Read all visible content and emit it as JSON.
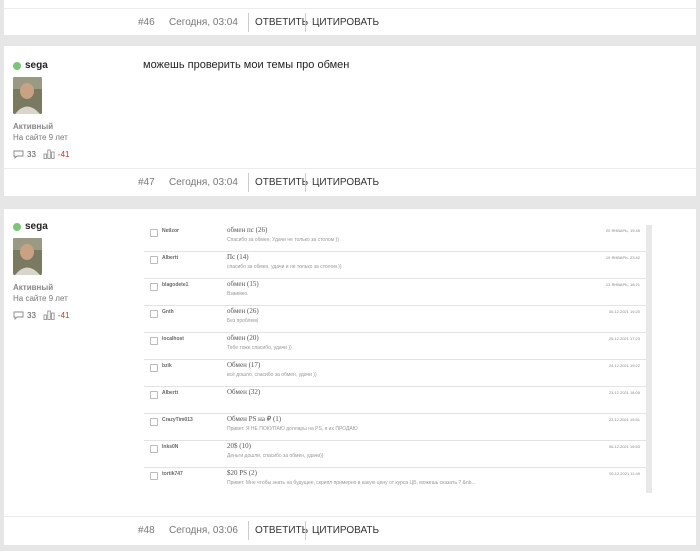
{
  "posts": [
    {
      "number": "#46",
      "date": "Сегодня, 03:04",
      "reply_label": "ОТВЕТИТЬ",
      "quote_label": "ЦИТИРОВАТЬ"
    },
    {
      "author": "sega",
      "status": "Активный",
      "tenure": "На сайте 9 лет",
      "comments": "33",
      "rating": "-41",
      "message": "можешь проверить мои темы про обмен",
      "number": "#47",
      "date": "Сегодня, 03:04",
      "reply_label": "ОТВЕТИТЬ",
      "quote_label": "ЦИТИРОВАТЬ"
    },
    {
      "author": "sega",
      "status": "Активный",
      "tenure": "На сайте 9 лет",
      "comments": "33",
      "rating": "-41",
      "number": "#48",
      "date": "Сегодня, 03:06",
      "reply_label": "ОТВЕТИТЬ",
      "quote_label": "ЦИТИРОВАТЬ",
      "screenshot_rows": [
        {
          "user": "NetIzor",
          "subject": "обмен пс",
          "count": "(26)",
          "snippet": "Спасибо за обмен, Удачи не только за столом ))",
          "date": "20 ЯНВАРЬ, 19:45"
        },
        {
          "user": "Albertt",
          "subject": "Пс",
          "count": "(14)",
          "snippet": "спасибо за обмен, удачи и не только за столом ))",
          "date": "19 ЯНВАРЬ, 23:42"
        },
        {
          "user": "blagodete1",
          "subject": "обмен",
          "count": "(15)",
          "snippet": "Взаимно.",
          "date": "13 ЯНВАРЬ, 18:21"
        },
        {
          "user": "Gnth",
          "subject": "обмен",
          "count": "(26)",
          "snippet": "Без проблем)",
          "date": "30.12.2021 19:20"
        },
        {
          "user": "localhost",
          "subject": "обмен",
          "count": "(20)",
          "snippet": "Тебе тоже спасибо, удачи ))",
          "date": "25.12.2021 17:23"
        },
        {
          "user": "bzik",
          "subject": "Обмен",
          "count": "(17)",
          "snippet": "всё дошло, спасибо за обмен, удачи ))",
          "date": "24.12.2021 19:22"
        },
        {
          "user": "Albertt",
          "subject": "Обмен",
          "count": "(32)",
          "snippet": "",
          "date": "23.12.2021 18:05"
        },
        {
          "user": "CrazyTim013",
          "subject": "Обмен PS на ₽",
          "count": "(1)",
          "snippet": "Привет. Я НЕ ПОКУПАЮ доллары на PS, я их ПРОДАЮ",
          "date": "23.12.2021 15:51"
        },
        {
          "user": "Inks0N",
          "subject": "20$",
          "count": "(10)",
          "snippet": "Деньги дошли, спасибо за обмен, удачи))",
          "date": "06.12.2021 16:53"
        },
        {
          "user": "tortik747",
          "subject": "$20 PS",
          "count": "(2)",
          "snippet": "Привет. Мне чтобы знать на будущее, скрипл примерно в какую цену от курса ЦБ, можешь сказать ? &nb...",
          "date": "05.12.2021 11:49"
        }
      ]
    }
  ]
}
